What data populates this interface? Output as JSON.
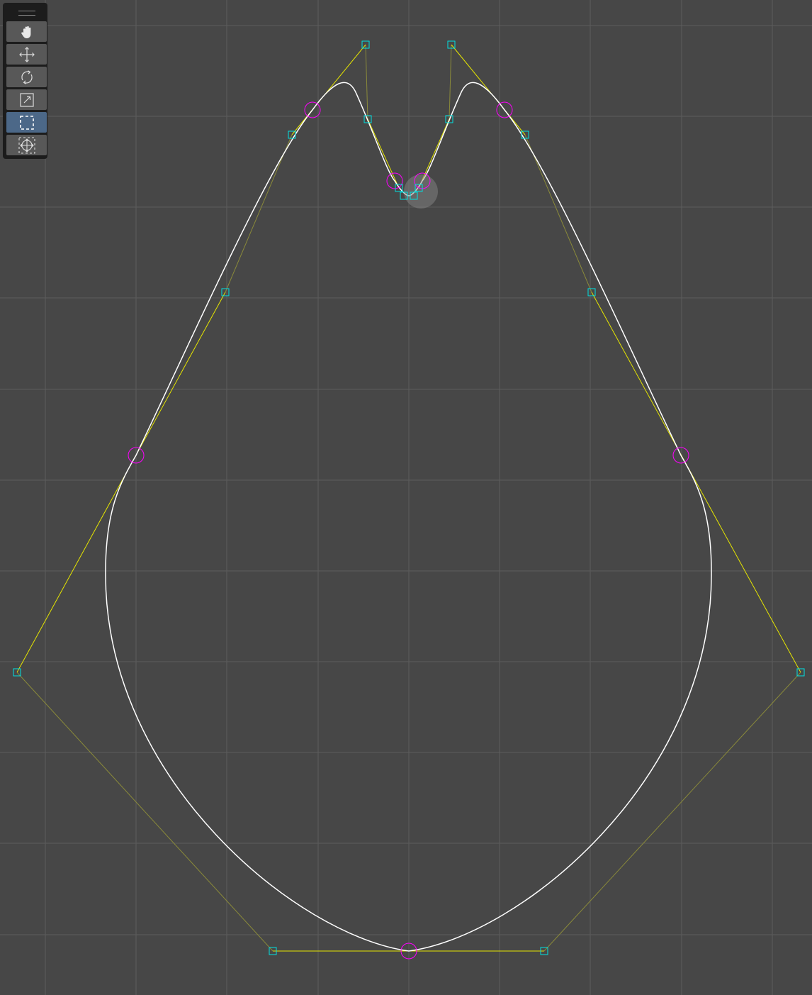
{
  "editor": {
    "active_tool": "select-box",
    "colors": {
      "background": "#474747",
      "grid": "#5d5d5d",
      "curve": "#ffffff",
      "handle_line": "#ffff00",
      "handle_line_dim": "#8a8a3a",
      "control_point": "#00e0e0",
      "knot": "#ff00ff",
      "toolbar_bg": "#1c1c1c",
      "tool_bg": "#585858",
      "tool_active_bg": "#4c6888"
    }
  },
  "toolbar": {
    "tools": [
      {
        "id": "pan",
        "icon": "hand-icon",
        "active": false
      },
      {
        "id": "move",
        "icon": "move-arrows-icon",
        "active": false
      },
      {
        "id": "rotate",
        "icon": "rotate-icon",
        "active": false
      },
      {
        "id": "scale",
        "icon": "scale-icon",
        "active": false
      },
      {
        "id": "select-box",
        "icon": "select-box-icon",
        "active": true
      },
      {
        "id": "transform",
        "icon": "transform-icon",
        "active": false
      }
    ]
  }
}
